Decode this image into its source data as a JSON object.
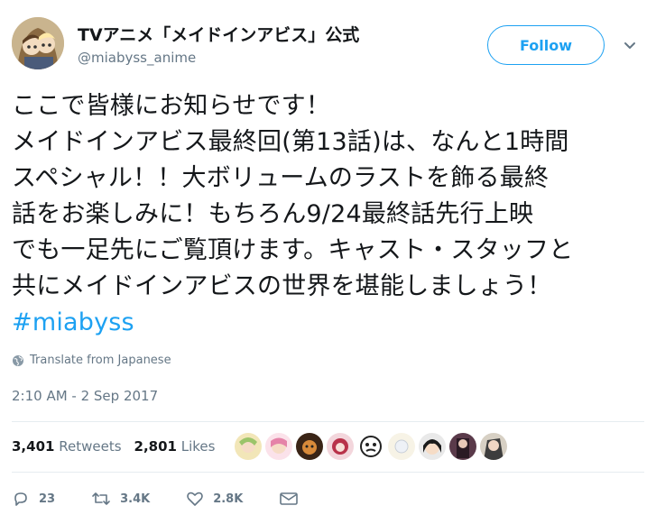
{
  "account": {
    "name": "TVアニメ「メイドインアビス」公式",
    "handle": "@miabyss_anime"
  },
  "follow_label": "Follow",
  "tweet": {
    "lines": [
      "ここで皆様にお知らせです！",
      "メイドインアビス最終回(第13話)は、なんと1時間",
      "スペシャル！！大ボリュームのラストを飾る最終",
      "話をお楽しみに！もちろん9/24最終話先行上映",
      "でも一足先にご覧頂けます。キャスト・スタッフと",
      "共にメイドインアビスの世界を堪能しましょう！"
    ],
    "hashtag": "#miabyss"
  },
  "translate_label": "Translate from Japanese",
  "timestamp": "2:10 AM - 2 Sep 2017",
  "stats": {
    "retweets_count": "3,401",
    "retweets_label": "Retweets",
    "likes_count": "2,801",
    "likes_label": "Likes"
  },
  "actions": {
    "replies": "23",
    "retweets": "3.4K",
    "likes": "2.8K"
  },
  "icons": [
    "globe-icon",
    "caret-down-icon",
    "reply-icon",
    "retweet-icon",
    "like-icon",
    "message-icon"
  ],
  "colors": {
    "accent": "#1da1f2",
    "secondary_text": "#657786",
    "divider": "#e6ecf0"
  }
}
